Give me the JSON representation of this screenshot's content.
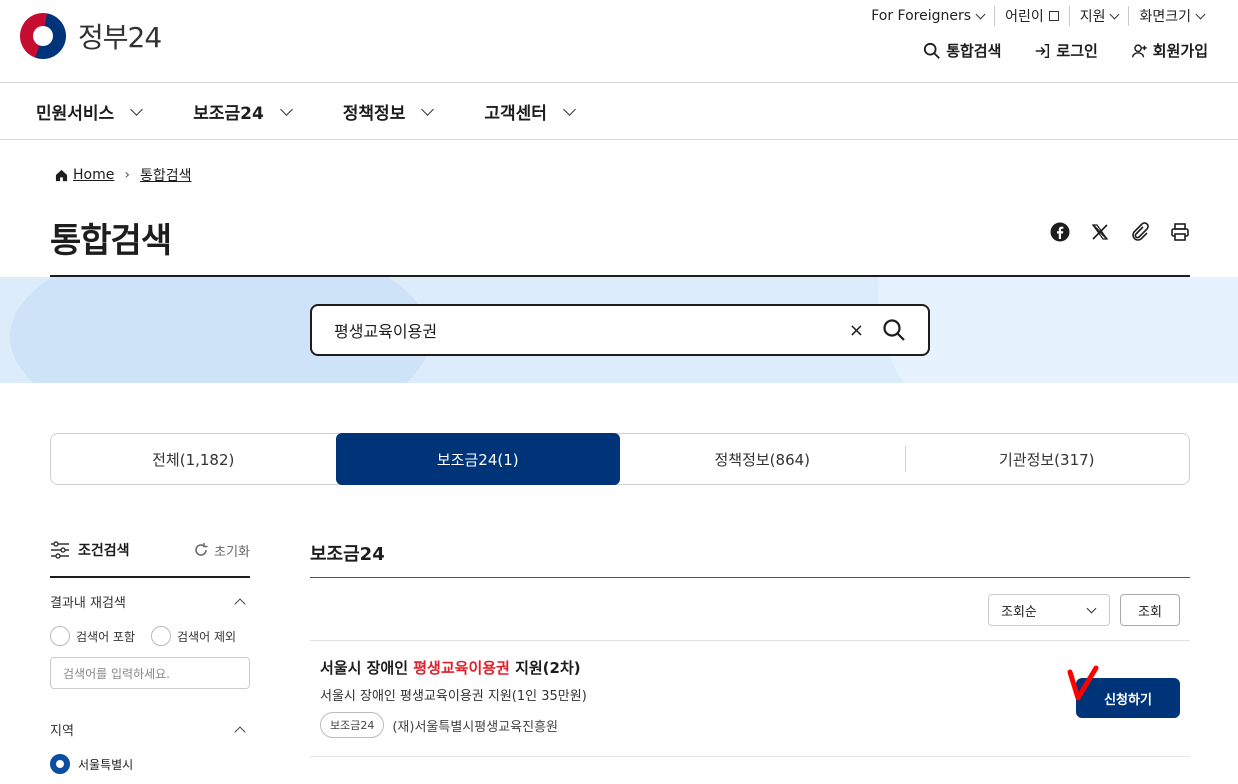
{
  "brand": {
    "name": "정부24"
  },
  "util_nav": [
    {
      "label": "For Foreigners",
      "has_dropdown": true
    },
    {
      "label": "어린이",
      "icon": "external-link-icon"
    },
    {
      "label": "지원",
      "has_dropdown": true
    },
    {
      "label": "화면크기",
      "has_dropdown": true
    }
  ],
  "main_actions": {
    "search": "통합검색",
    "login": "로그인",
    "signup": "회원가입"
  },
  "gnb": [
    "민원서비스",
    "보조금24",
    "정책정보",
    "고객센터"
  ],
  "breadcrumb": {
    "home": "Home",
    "current": "통합검색"
  },
  "page_title": "통합검색",
  "share_icons": [
    "facebook-icon",
    "x-icon",
    "clip-icon",
    "print-icon"
  ],
  "search": {
    "value": "평생교육이용권",
    "clear": "×"
  },
  "tabs": [
    {
      "label": "전체(1,182)",
      "active": false
    },
    {
      "label": "보조금24(1)",
      "active": true
    },
    {
      "label": "정책정보(864)",
      "active": false
    },
    {
      "label": "기관정보(317)",
      "active": false
    }
  ],
  "filter": {
    "title": "조건검색",
    "reset": "초기화",
    "research_title": "결과내 재검색",
    "include_kw": "검색어 포함",
    "exclude_kw": "검색어 제외",
    "kw_placeholder": "검색어를 입력하세요.",
    "region_title": "지역",
    "region_selected": "서울특별시"
  },
  "results": {
    "section_title": "보조금24",
    "sort_value": "조회순",
    "sort_button": "조회",
    "items": [
      {
        "title_pre": "서울시 장애인 ",
        "title_hl": "평생교육이용권",
        "title_post": " 지원(2차)",
        "desc": "서울시 장애인 평생교육이용권 지원(1인 35만원)",
        "badge": "보조금24",
        "org": "(재)서울특별시평생교육진흥원",
        "apply": "신청하기"
      }
    ]
  },
  "colors": {
    "primary": "#003478",
    "highlight": "#e11d2a",
    "band": "#dcecfb"
  }
}
